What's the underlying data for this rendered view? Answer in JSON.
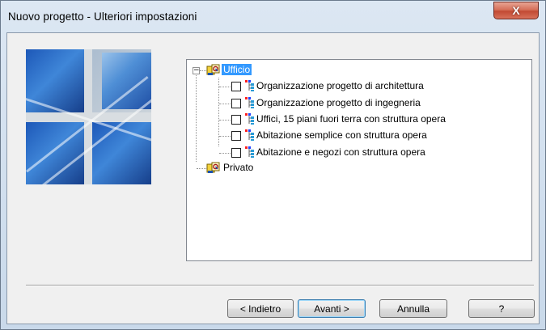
{
  "window": {
    "title": "Nuovo progetto - Ulteriori impostazioni",
    "close_glyph": "X"
  },
  "tree": {
    "root": {
      "label": "Ufficio",
      "expander": "−",
      "selected": true,
      "icon": "group-icon",
      "children": [
        {
          "label": "Organizzazione progetto di architettura",
          "checked": false,
          "icon": "template-icon"
        },
        {
          "label": "Organizzazione progetto di ingegneria",
          "checked": false,
          "icon": "template-icon"
        },
        {
          "label": "Uffici, 15 piani fuori terra con struttura opera",
          "checked": false,
          "icon": "template-icon"
        },
        {
          "label": "Abitazione semplice con struttura opera",
          "checked": false,
          "icon": "template-icon"
        },
        {
          "label": "Abitazione e negozi con struttura opera",
          "checked": false,
          "icon": "template-icon"
        }
      ]
    },
    "second": {
      "label": "Privato",
      "icon": "group-icon"
    }
  },
  "buttons": {
    "back": "< Indietro",
    "next": "Avanti >",
    "cancel": "Annulla",
    "help": "?"
  },
  "colors": {
    "selection": "#3399ff",
    "title_gradient_top": "#dce7f3",
    "close_button": "#c24a33"
  }
}
